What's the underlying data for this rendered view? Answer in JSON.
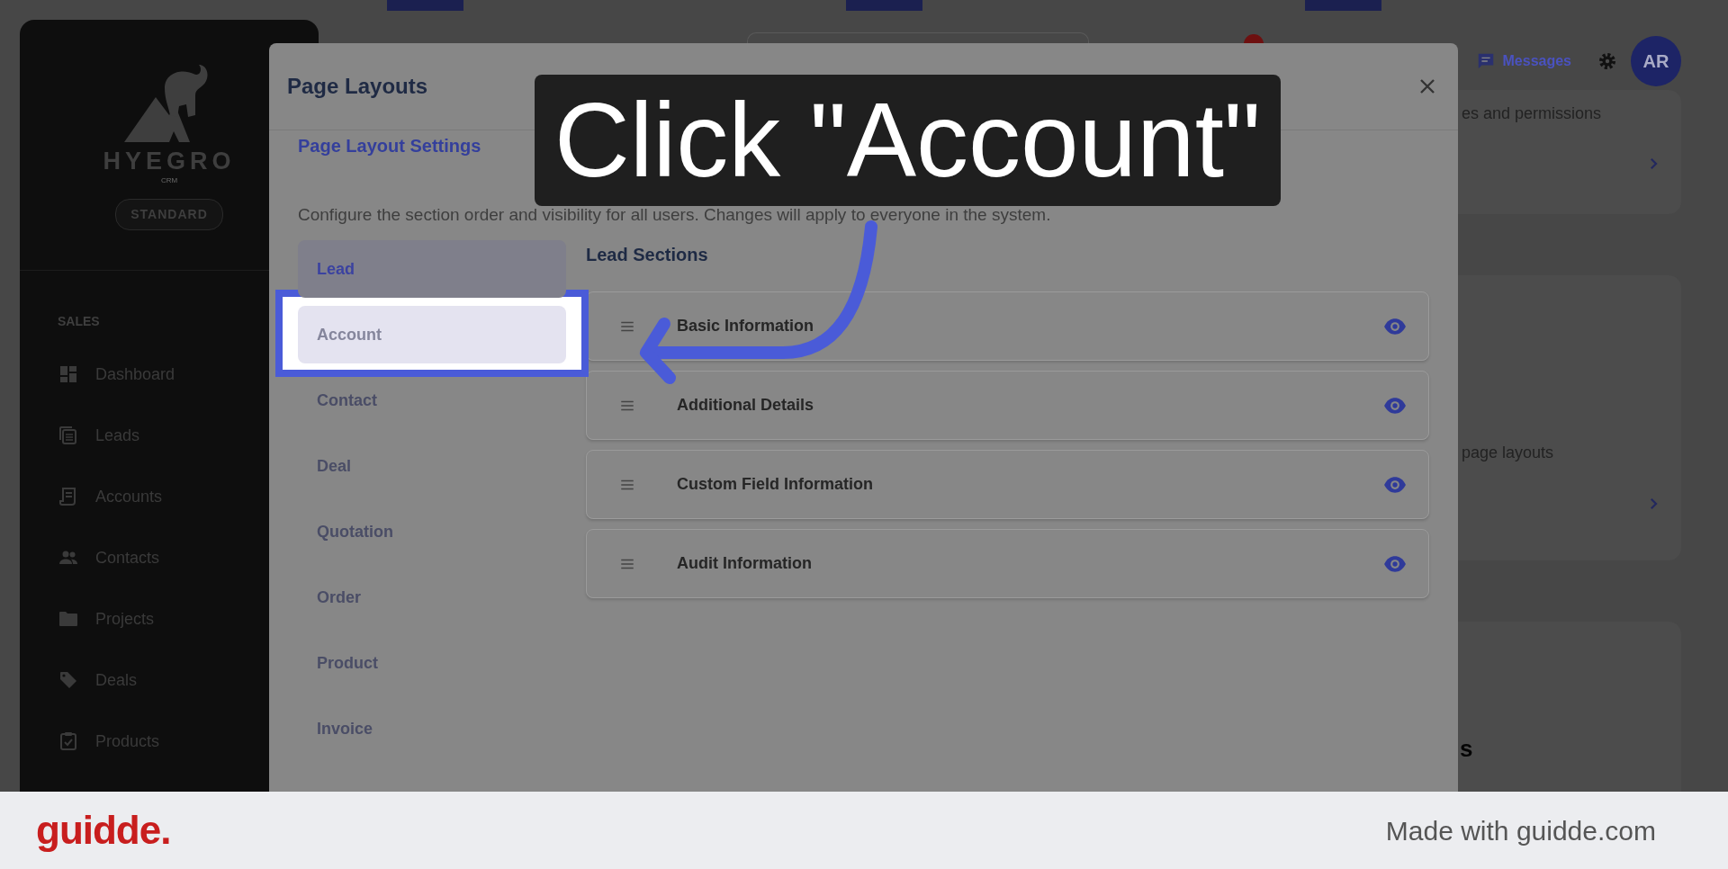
{
  "sidebar": {
    "logo_text": "HYEGRO",
    "logo_subtext": "CRM",
    "plan_badge": "STANDARD",
    "section": "SALES",
    "items": [
      {
        "label": "Dashboard"
      },
      {
        "label": "Leads"
      },
      {
        "label": "Accounts"
      },
      {
        "label": "Contacts"
      },
      {
        "label": "Projects"
      },
      {
        "label": "Deals"
      },
      {
        "label": "Products"
      }
    ]
  },
  "header": {
    "messages": "Messages",
    "avatar": "AR"
  },
  "background_cards": [
    {
      "text": "es and permissions",
      "kind": "link"
    },
    {
      "text": "page layouts",
      "kind": "link"
    },
    {
      "text": "s",
      "kind": "heading"
    }
  ],
  "modal": {
    "title": "Page Layouts",
    "subtitle": "Page Layout Settings",
    "description": "Configure the section order and visibility for all users. Changes will apply to everyone in the system.",
    "entities": [
      {
        "label": "Lead",
        "selected": true,
        "highlighted": false
      },
      {
        "label": "Account",
        "selected": false,
        "highlighted": true
      },
      {
        "label": "Contact",
        "selected": false,
        "highlighted": false
      },
      {
        "label": "Deal",
        "selected": false,
        "highlighted": false
      },
      {
        "label": "Quotation",
        "selected": false,
        "highlighted": false
      },
      {
        "label": "Order",
        "selected": false,
        "highlighted": false
      },
      {
        "label": "Product",
        "selected": false,
        "highlighted": false
      },
      {
        "label": "Invoice",
        "selected": false,
        "highlighted": false
      }
    ],
    "sections_title": "Lead Sections",
    "sections": [
      {
        "name": "Basic Information",
        "visible": true
      },
      {
        "name": "Additional Details",
        "visible": true
      },
      {
        "name": "Custom Field Information",
        "visible": true
      },
      {
        "name": "Audit Information",
        "visible": true
      }
    ]
  },
  "callout": {
    "text": "Click \"Account\""
  },
  "footer": {
    "logo": "guidde.",
    "credit": "Made with guidde.com"
  }
}
